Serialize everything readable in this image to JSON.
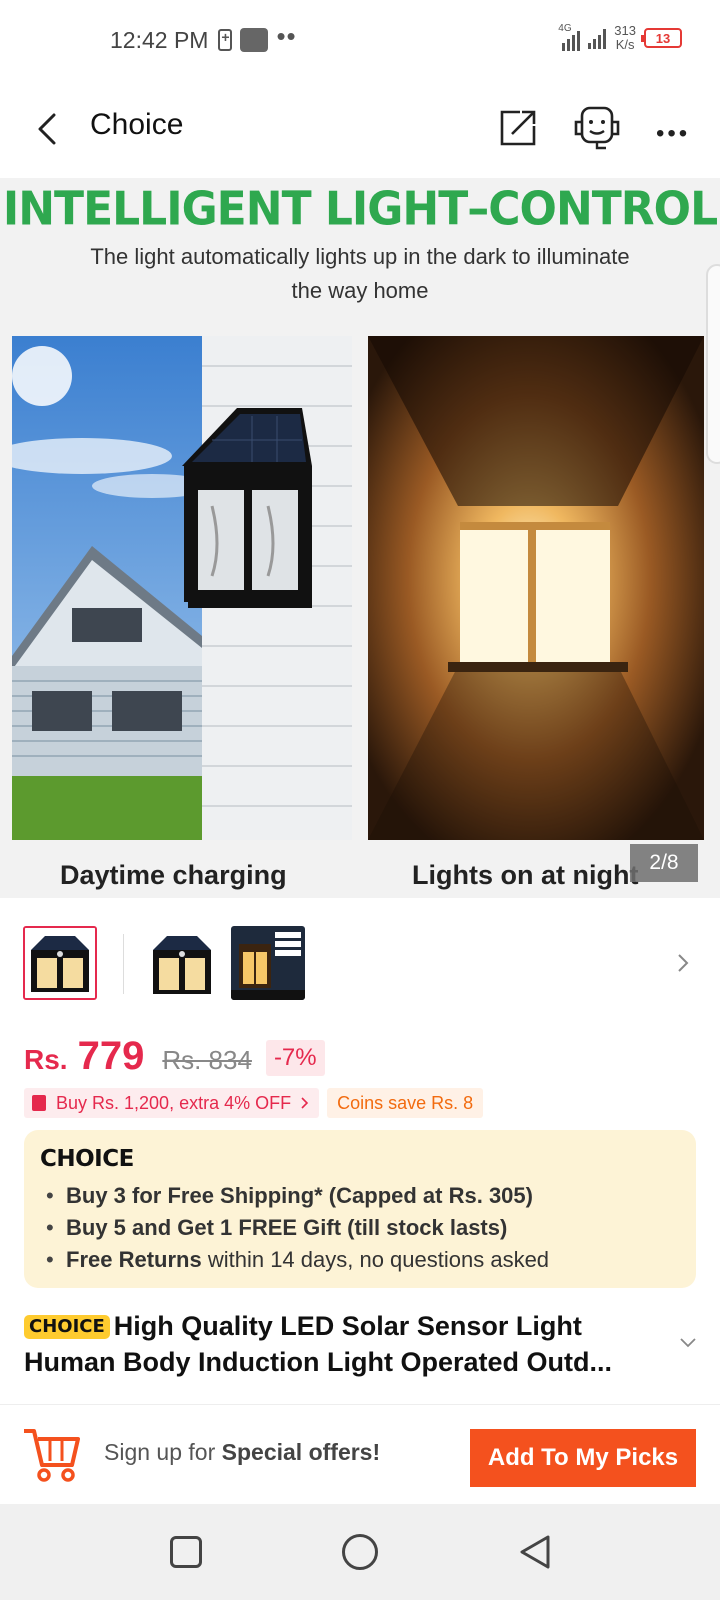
{
  "status_bar": {
    "time": "12:42 PM",
    "network": "4G",
    "speed_value": "313",
    "speed_unit": "K/s",
    "battery": "13"
  },
  "header": {
    "title": "Choice",
    "back_icon": "back-arrow-icon",
    "share_icon": "share-icon",
    "support_icon": "customer-service-icon",
    "more_icon": "more-icon"
  },
  "gallery": {
    "headline": "INTELLIGENT LIGHT–CONTROL",
    "subtitle": "The light automatically lights up in the dark to illuminate the way home",
    "caption_left": "Daytime charging",
    "caption_right": "Lights on at night",
    "counter": "2/8",
    "thumbnail_count": 3
  },
  "price": {
    "currency": "Rs.",
    "current": "779",
    "original": "Rs. 834",
    "discount": "-7%"
  },
  "promos": {
    "bundle": "Buy Rs. 1,200, extra 4% OFF",
    "coins": "Coins save Rs. 8"
  },
  "choice_box": {
    "logo": "CHOICE",
    "items": [
      {
        "bold": "Buy 3 for  Free Shipping* (Capped at Rs. 305)",
        "rest": ""
      },
      {
        "bold": "Buy 5 and Get 1 FREE Gift (till stock lasts)",
        "rest": ""
      },
      {
        "bold": "Free Returns",
        "rest": " within 14 days, no questions asked"
      }
    ]
  },
  "product": {
    "badge": "CHOICE",
    "title_line1": "High Quality LED Solar Sensor Light",
    "title_line2": "Human Body Induction Light Operated Outd..."
  },
  "bottom_bar": {
    "signup_prefix": "Sign up for ",
    "signup_bold": "Special offers!",
    "add_button": "Add To My Picks"
  },
  "colors": {
    "price_red": "#e5294d",
    "headline_green": "#2fa84f",
    "cta_orange": "#f4511e",
    "choice_bg": "#fdf3d6",
    "choice_badge": "#fecb2f"
  }
}
